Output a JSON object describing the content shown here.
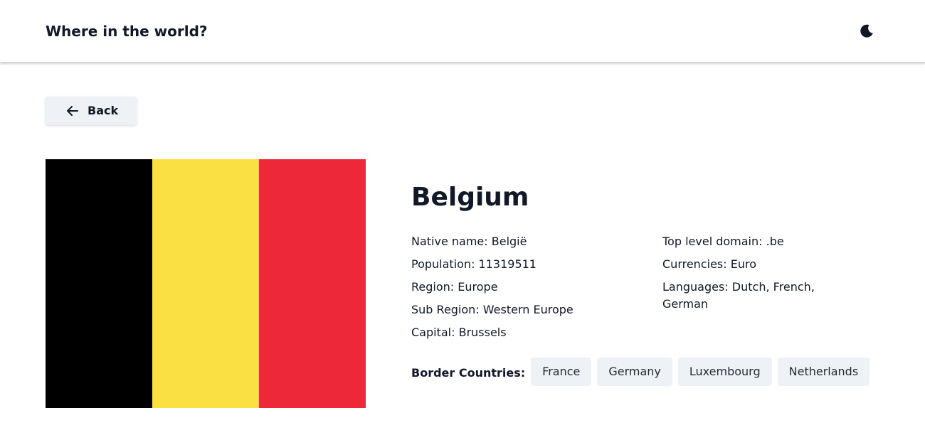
{
  "header": {
    "title": "Where in the world?",
    "theme_toggle_icon": "moon-icon"
  },
  "back_button": {
    "label": "Back",
    "icon": "arrow-left-icon"
  },
  "flag": {
    "country": "Belgium",
    "colors": [
      "#000000",
      "#fae042",
      "#ed2939"
    ]
  },
  "country": {
    "name": "Belgium",
    "details_left": [
      {
        "label": "Native name:",
        "value": "België"
      },
      {
        "label": "Population:",
        "value": "11319511"
      },
      {
        "label": "Region:",
        "value": "Europe"
      },
      {
        "label": "Sub Region:",
        "value": "Western Europe"
      },
      {
        "label": "Capital:",
        "value": "Brussels"
      }
    ],
    "details_right": [
      {
        "label": "Top level domain:",
        "value": ".be"
      },
      {
        "label": "Currencies:",
        "value": "Euro"
      },
      {
        "label": "Languages:",
        "value": "Dutch, French, German"
      }
    ],
    "border_label": "Border Countries:",
    "border_countries": [
      "France",
      "Germany",
      "Luxembourg",
      "Netherlands"
    ]
  },
  "colors": {
    "chip_background": "#eef1f5",
    "text": "#111827"
  }
}
